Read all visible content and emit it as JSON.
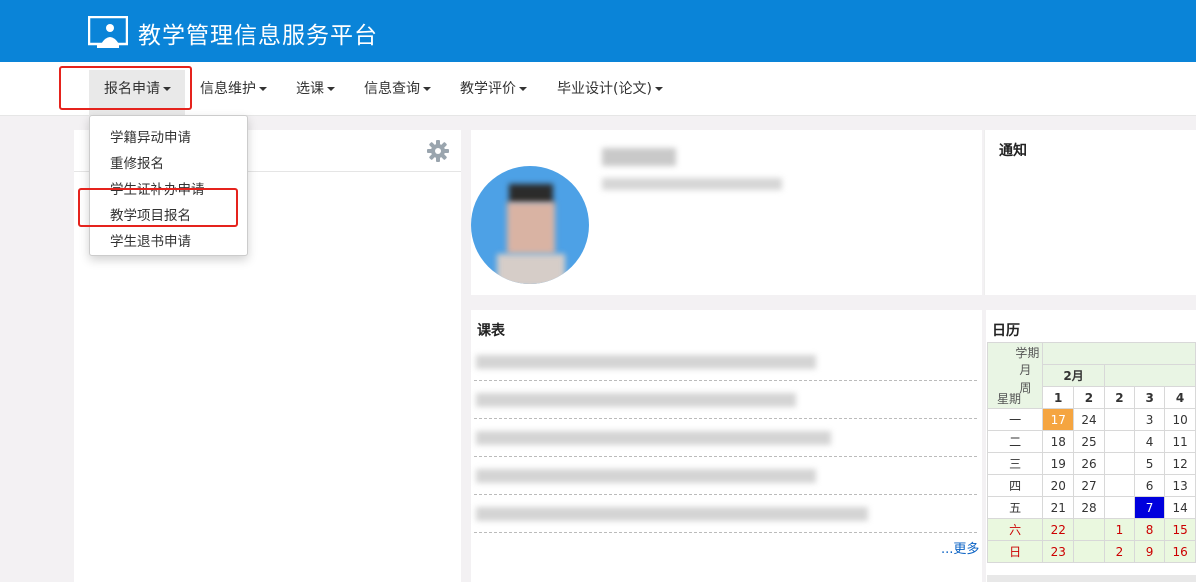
{
  "header": {
    "title": "教学管理信息服务平台",
    "logo_icon": "presentation-screen-icon"
  },
  "nav": {
    "items": [
      {
        "label": "报名申请"
      },
      {
        "label": "信息维护"
      },
      {
        "label": "选课"
      },
      {
        "label": "信息查询"
      },
      {
        "label": "教学评价"
      },
      {
        "label": "毕业设计(论文)"
      }
    ]
  },
  "dropdown": {
    "items": [
      "学籍异动申请",
      "重修报名",
      "学生证补办申请",
      "教学项目报名",
      "学生退书申请"
    ]
  },
  "notice": {
    "title": "通知"
  },
  "schedule": {
    "title": "课表",
    "more": "...更多"
  },
  "calendar": {
    "title": "日历",
    "header_term": "学期",
    "header_month_label": "月",
    "header_week_label": "周",
    "header_weekday_label": "星期",
    "month": "2月",
    "week_numbers": [
      "1",
      "2",
      "2",
      "3",
      "4"
    ],
    "rows": [
      {
        "day": "一",
        "cells": [
          "17",
          "24",
          "",
          "3",
          "10"
        ]
      },
      {
        "day": "二",
        "cells": [
          "18",
          "25",
          "",
          "4",
          "11"
        ]
      },
      {
        "day": "三",
        "cells": [
          "19",
          "26",
          "",
          "5",
          "12"
        ]
      },
      {
        "day": "四",
        "cells": [
          "20",
          "27",
          "",
          "6",
          "13"
        ]
      },
      {
        "day": "五",
        "cells": [
          "21",
          "28",
          "",
          "7",
          "14"
        ]
      },
      {
        "day": "六",
        "cells": [
          "22",
          "",
          "1",
          "8",
          "15"
        ]
      },
      {
        "day": "日",
        "cells": [
          "23",
          "",
          "2",
          "9",
          "16"
        ]
      }
    ],
    "today_color": "#f5a540",
    "selected_color": "#0000dd"
  },
  "colors": {
    "brand": "#0a84d8",
    "highlight_box": "#e5231d",
    "link": "#0a62c4"
  }
}
